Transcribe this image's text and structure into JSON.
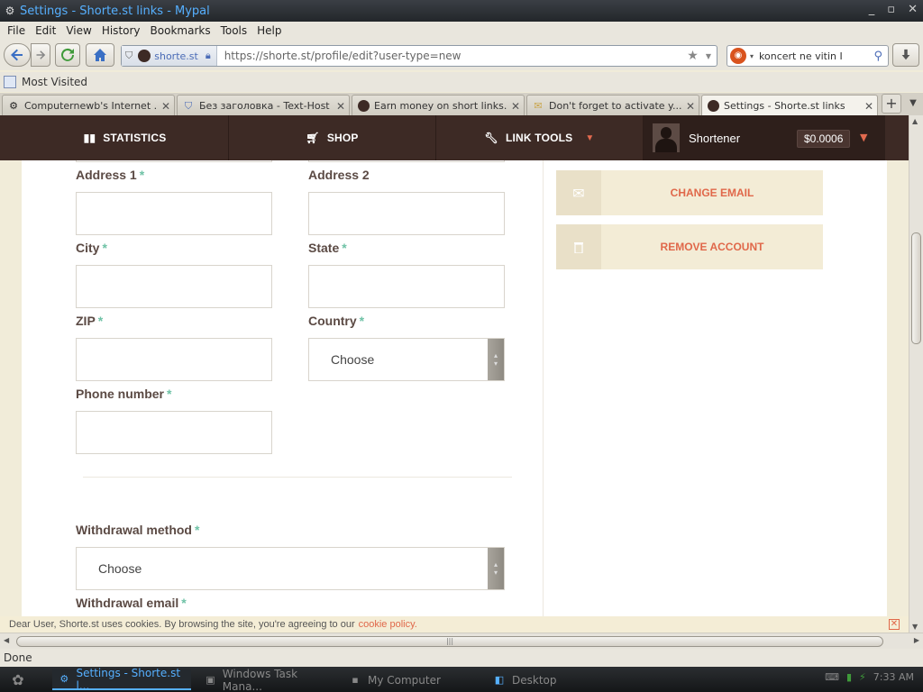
{
  "window": {
    "title": "Settings - Shorte.st links - Mypal",
    "controls": [
      "_",
      "▫",
      "✕"
    ]
  },
  "menu": [
    "File",
    "Edit",
    "View",
    "History",
    "Bookmarks",
    "Tools",
    "Help"
  ],
  "nav": {
    "identity_site": "shorte.st",
    "url": "https://shorte.st/profile/edit?user-type=new",
    "search_value": "koncert ne vitin I"
  },
  "bookmarks": {
    "most_visited": "Most Visited"
  },
  "tabs": [
    {
      "label": "Computernewb's Internet ...",
      "active": false
    },
    {
      "label": "Без заголовка - Text-Host - ...",
      "active": false
    },
    {
      "label": "Earn money on short links...",
      "active": false
    },
    {
      "label": "Don't forget to activate y...",
      "active": false
    },
    {
      "label": "Settings - Shorte.st links",
      "active": true
    }
  ],
  "site_nav": {
    "statistics": "STATISTICS",
    "shop": "SHOP",
    "link_tools": "LINK TOOLS",
    "username": "Shortener",
    "balance": "$0.0006"
  },
  "form": {
    "address1_label": "Address 1",
    "address2_label": "Address 2",
    "city_label": "City",
    "state_label": "State",
    "zip_label": "ZIP",
    "country_label": "Country",
    "country_value": "Choose",
    "phone_label": "Phone number",
    "withdrawal_method_label": "Withdrawal method",
    "withdrawal_method_value": "Choose",
    "withdrawal_email_label": "Withdrawal email",
    "required_mark": "*"
  },
  "sidebar": {
    "change_email": "CHANGE EMAIL",
    "remove_account": "REMOVE ACCOUNT"
  },
  "cookie": {
    "text": "Dear User, Shorte.st uses cookies. By browsing the site, you're agreeing to our",
    "link": "cookie policy."
  },
  "status": "Done",
  "taskbar": {
    "tasks": [
      "Settings - Shorte.st l...",
      "Windows Task Mana...",
      "My Computer",
      "Desktop"
    ],
    "clock": "7:33 AM"
  },
  "colors": {
    "site_nav_bg": "#3d2a25",
    "accent": "#e0684a",
    "required": "#6fc2a6",
    "page_bg": "#f1ecd9"
  }
}
